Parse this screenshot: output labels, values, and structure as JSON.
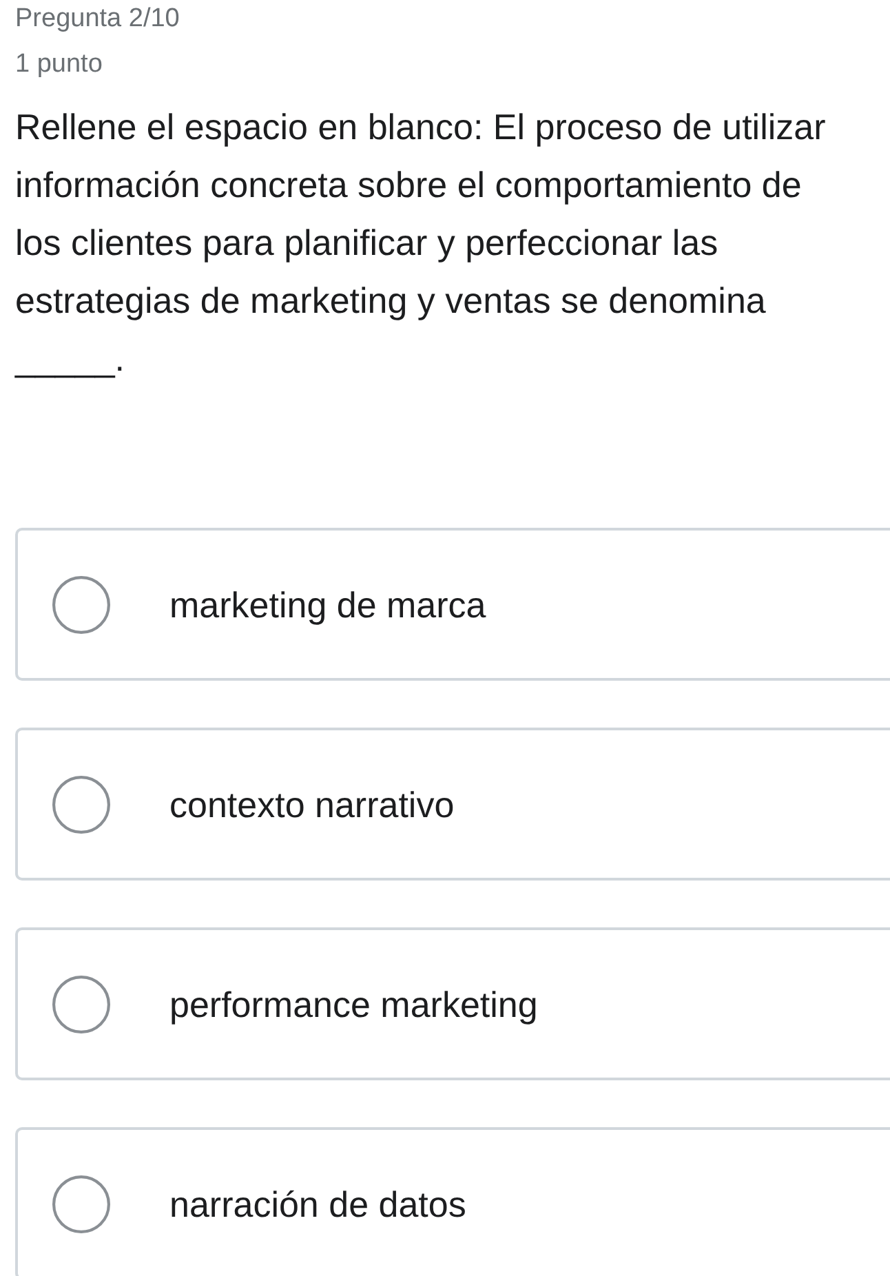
{
  "header": {
    "question_number": "Pregunta 2/10",
    "points": "1 punto"
  },
  "question": "Rellene el espacio en blanco: El proceso de utilizar información concreta sobre el comportamiento de los clientes para planificar y perfeccionar las estrategias de marketing y ventas se denomina _____.",
  "options": [
    {
      "label": "marketing de marca",
      "selected": false
    },
    {
      "label": "contexto narrativo",
      "selected": false
    },
    {
      "label": "performance marketing",
      "selected": false
    },
    {
      "label": "narración de datos",
      "selected": false
    }
  ]
}
